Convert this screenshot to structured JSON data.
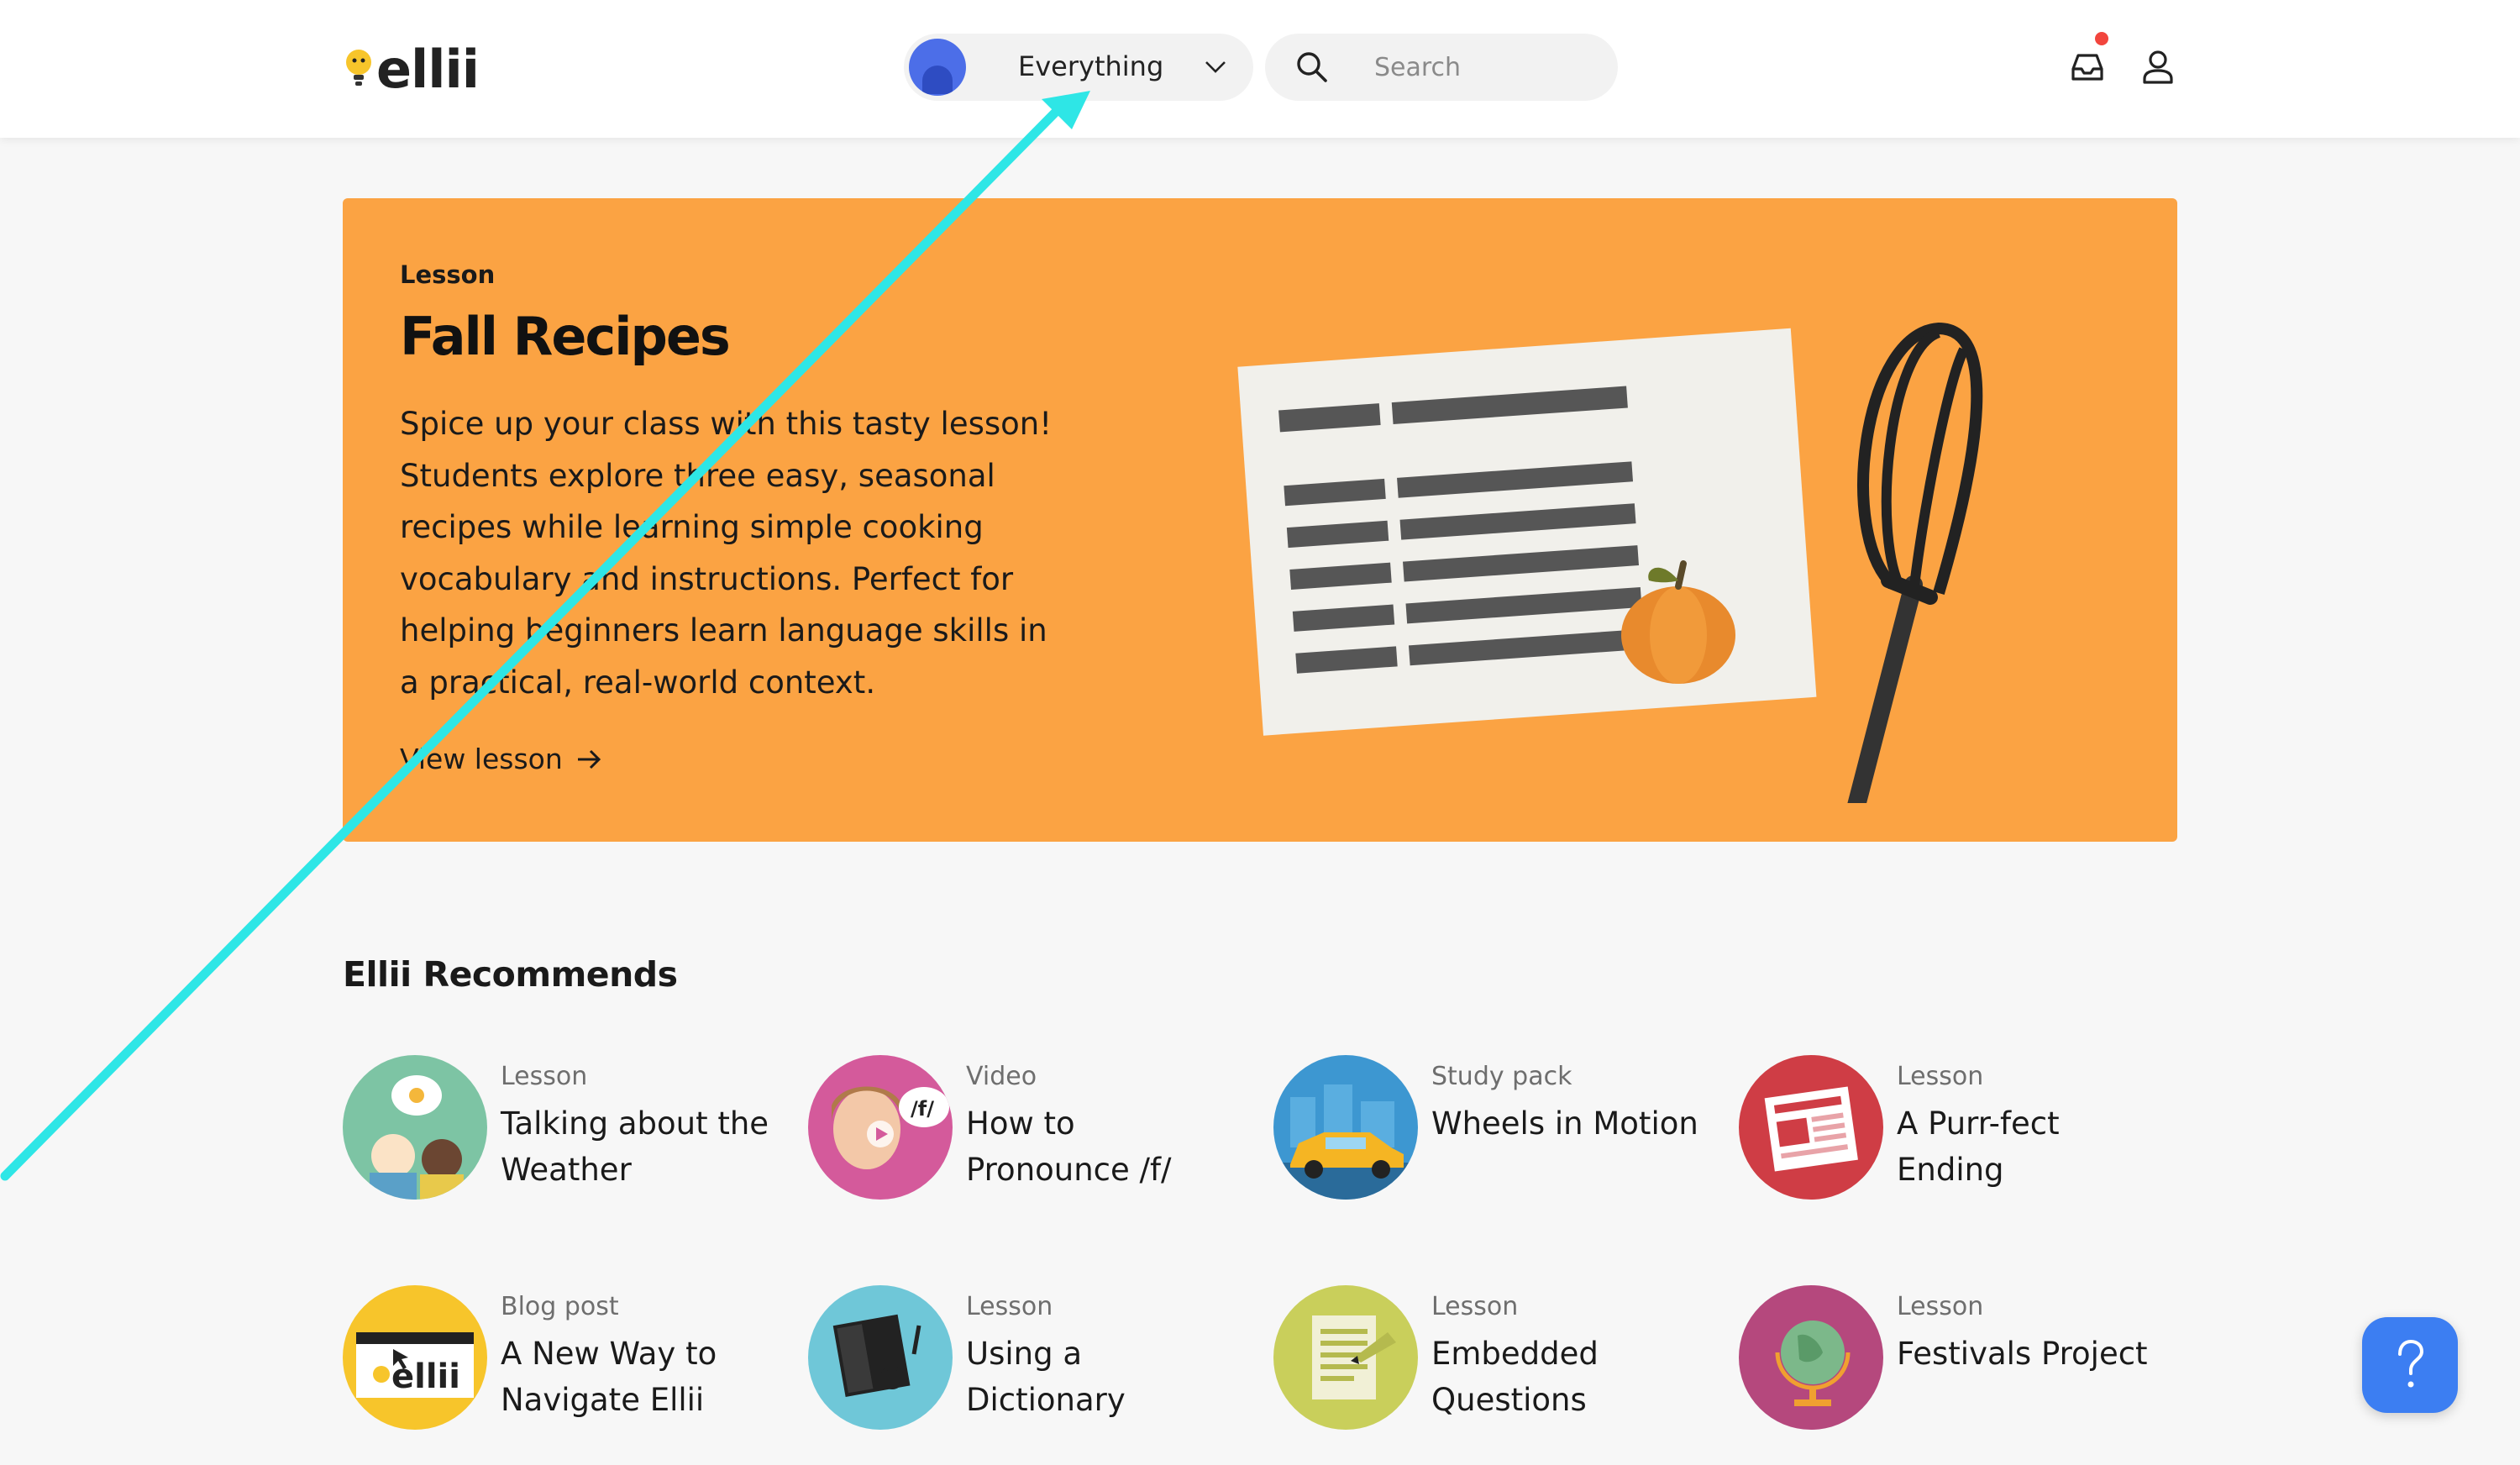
{
  "header": {
    "logo_text": "ellii",
    "filter": {
      "selected": "Everything"
    },
    "search": {
      "placeholder": "Search"
    },
    "notification_color": "#f2453d"
  },
  "hero": {
    "eyebrow": "Lesson",
    "title": "Fall Recipes",
    "description": "Spice up your class with this tasty lesson! Students explore three easy, seasonal recipes while learning simple cooking vocabulary and instructions. Perfect for helping beginners learn language skills in a practical, real-world context.",
    "link_label": "View lesson",
    "background": "#fba343"
  },
  "recommends": {
    "title": "Ellii Recommends",
    "cards": [
      {
        "type": "Lesson",
        "title": "Talking about the Weather",
        "icon": "weather-thumbnail"
      },
      {
        "type": "Video",
        "title": "How to Pronounce /f/",
        "icon": "pronounce-video-thumbnail"
      },
      {
        "type": "Study pack",
        "title": "Wheels in Motion",
        "icon": "taxi-thumbnail"
      },
      {
        "type": "Lesson",
        "title": "A Purr-fect Ending",
        "icon": "newspaper-thumbnail"
      },
      {
        "type": "Blog post",
        "title": "A New Way to Navigate Ellii",
        "icon": "ellii-website-thumbnail"
      },
      {
        "type": "Lesson",
        "title": "Using a Dictionary",
        "icon": "dictionary-thumbnail"
      },
      {
        "type": "Lesson",
        "title": "Embedded Questions",
        "icon": "document-thumbnail"
      },
      {
        "type": "Lesson",
        "title": "Festivals Project",
        "icon": "globe-thumbnail"
      }
    ]
  },
  "help_button": {
    "label": "?",
    "color": "#3c7ef2"
  },
  "annotation": {
    "color": "#2ee6e6"
  }
}
